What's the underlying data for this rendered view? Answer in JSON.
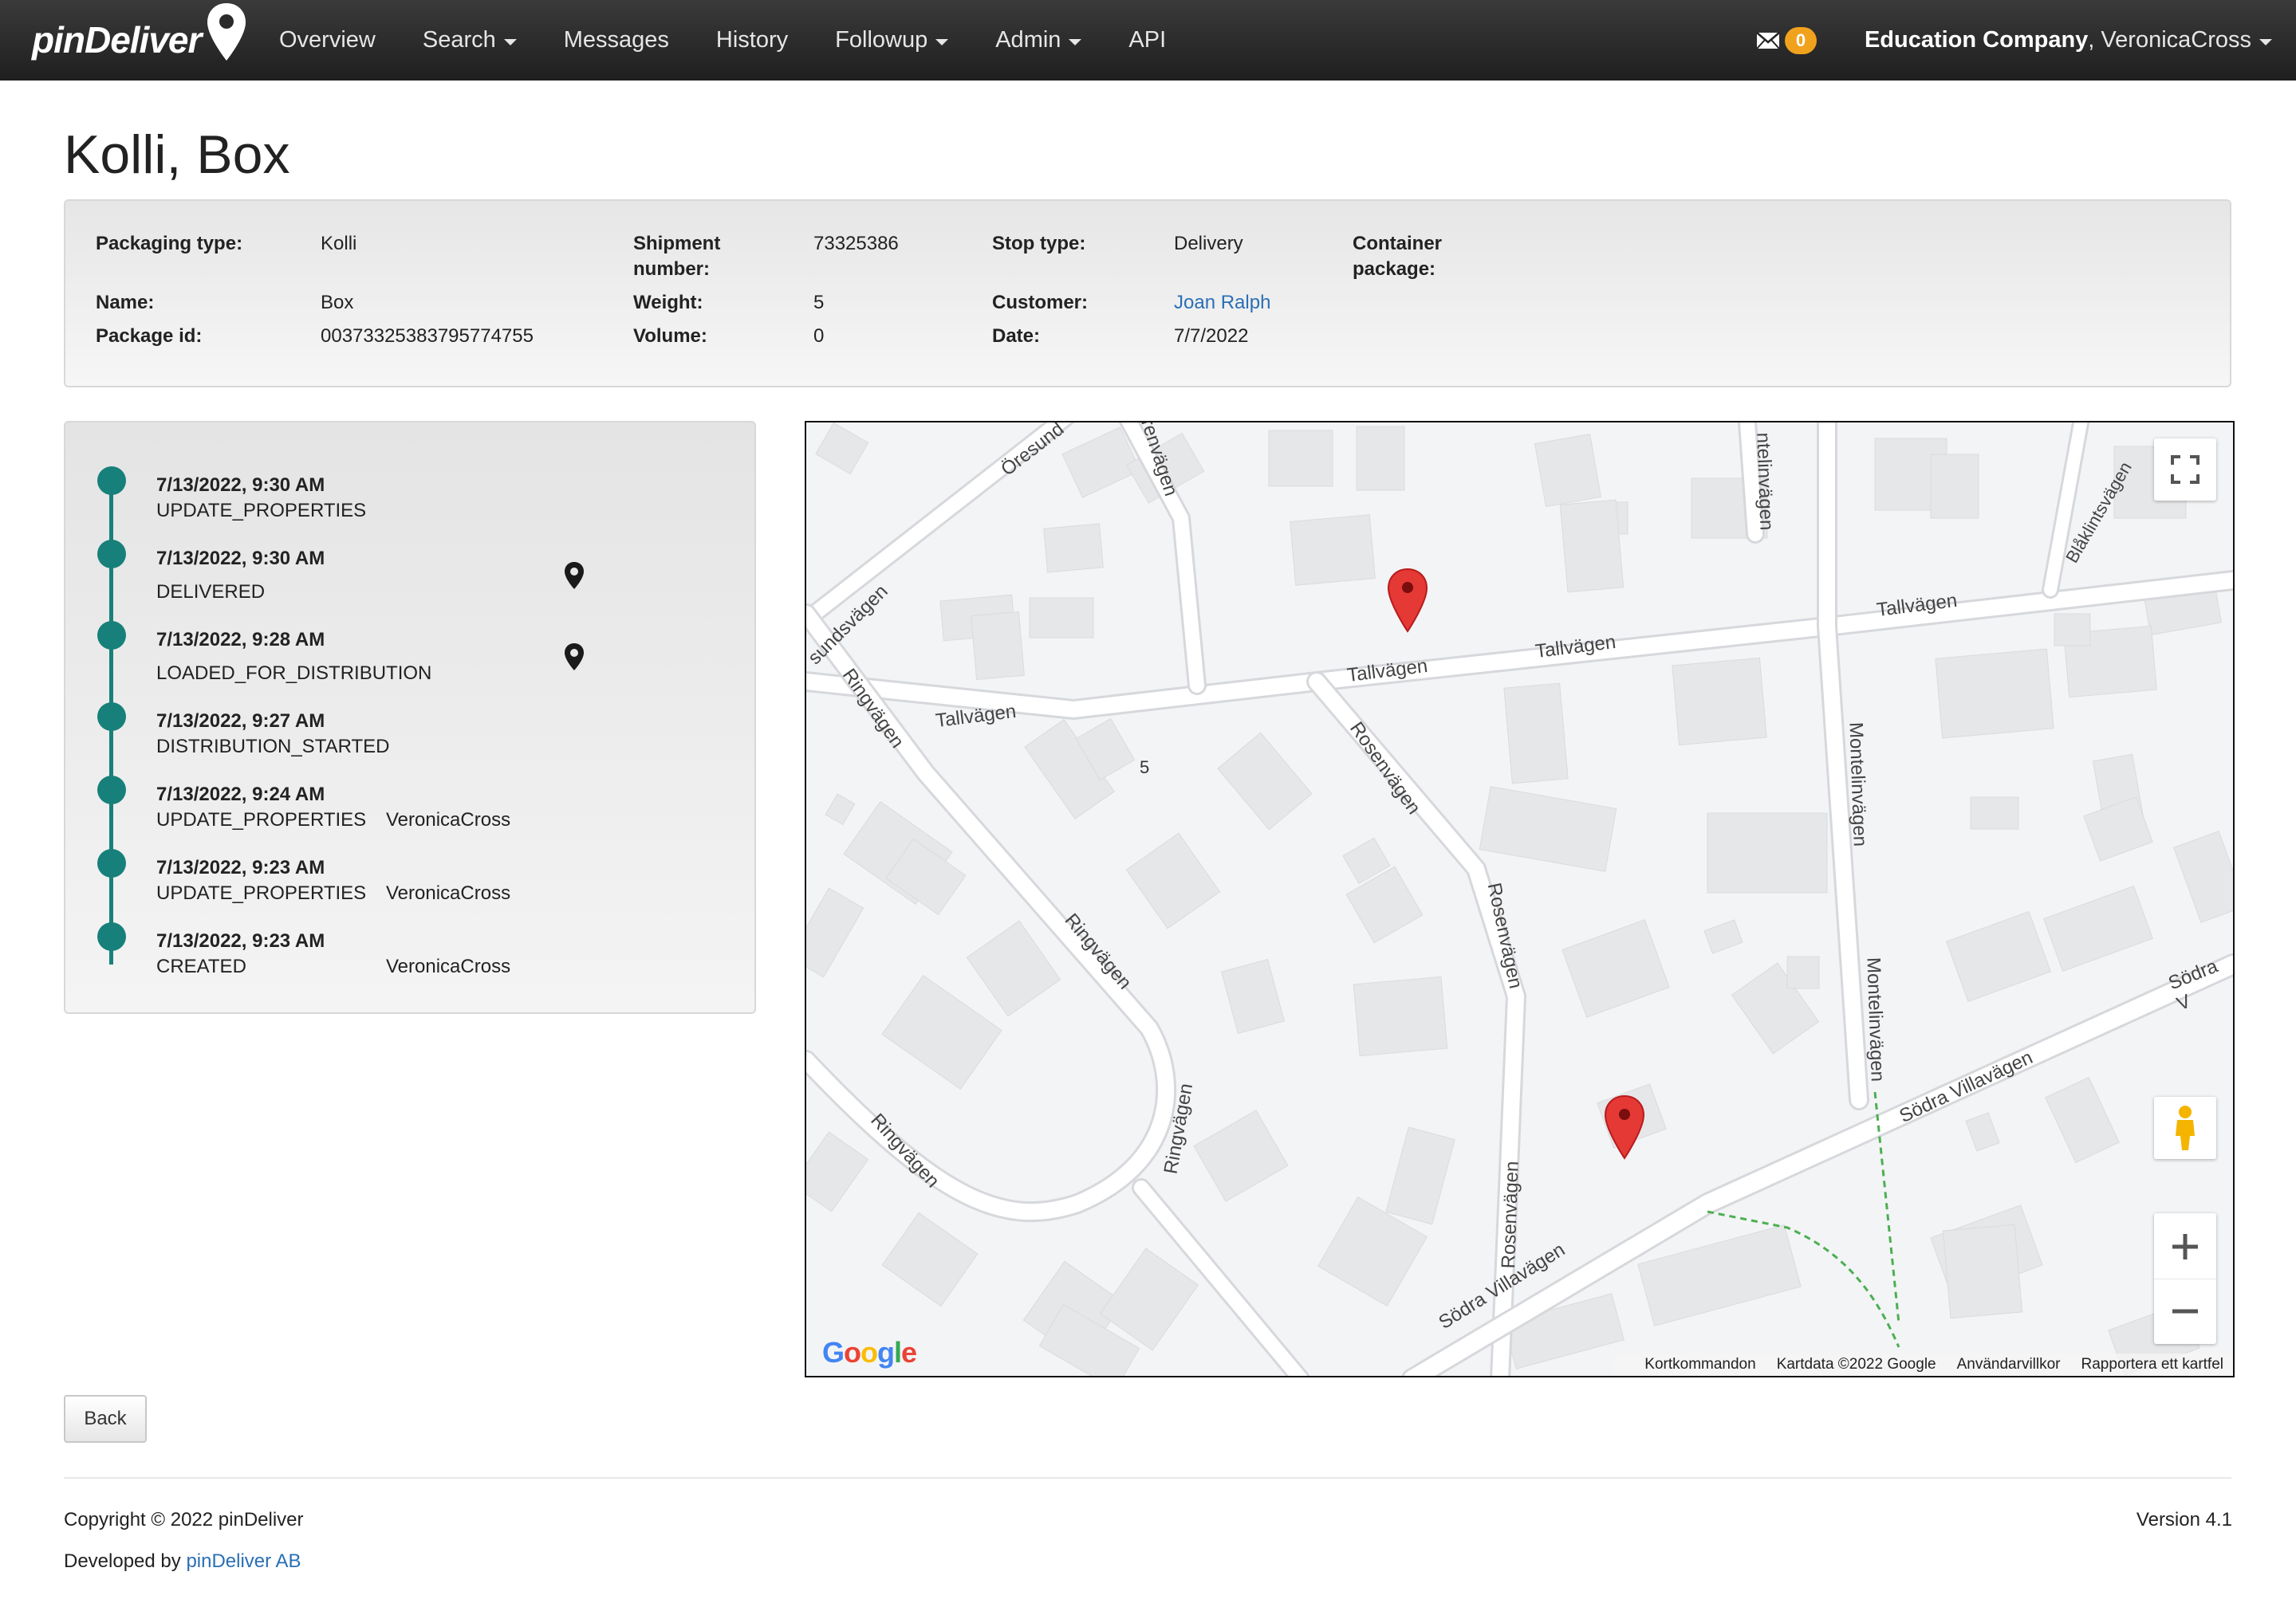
{
  "navbar": {
    "brand": "pinDeliver",
    "items": [
      {
        "label": "Overview",
        "dropdown": false
      },
      {
        "label": "Search",
        "dropdown": true
      },
      {
        "label": "Messages",
        "dropdown": false
      },
      {
        "label": "History",
        "dropdown": false
      },
      {
        "label": "Followup",
        "dropdown": true
      },
      {
        "label": "Admin",
        "dropdown": true
      },
      {
        "label": "API",
        "dropdown": false
      }
    ],
    "message_count": "0",
    "company": "Education Company",
    "user": ", VeronicaCross"
  },
  "page": {
    "title": "Kolli, Box"
  },
  "info": {
    "packaging_type_label": "Packaging type:",
    "packaging_type": "Kolli",
    "name_label": "Name:",
    "name": "Box",
    "package_id_label": "Package id:",
    "package_id": "00373325383795774755",
    "shipment_number_label": "Shipment number:",
    "shipment_number": "73325386",
    "weight_label": "Weight:",
    "weight": "5",
    "volume_label": "Volume:",
    "volume": "0",
    "stop_type_label": "Stop type:",
    "stop_type": "Delivery",
    "customer_label": "Customer:",
    "customer": "Joan Ralph",
    "date_label": "Date:",
    "date": "7/7/2022",
    "container_label": "Container package:"
  },
  "events": [
    {
      "time": "7/13/2022, 9:30 AM",
      "type": "UPDATE_PROPERTIES",
      "user": "",
      "pin": false
    },
    {
      "time": "7/13/2022, 9:30 AM",
      "type": "DELIVERED",
      "user": "",
      "pin": true
    },
    {
      "time": "7/13/2022, 9:28 AM",
      "type": "LOADED_FOR_DISTRIBUTION",
      "user": "",
      "pin": true
    },
    {
      "time": "7/13/2022, 9:27 AM",
      "type": "DISTRIBUTION_STARTED",
      "user": "",
      "pin": false
    },
    {
      "time": "7/13/2022, 9:24 AM",
      "type": "UPDATE_PROPERTIES",
      "user": "VeronicaCross",
      "pin": false
    },
    {
      "time": "7/13/2022, 9:23 AM",
      "type": "UPDATE_PROPERTIES",
      "user": "VeronicaCross",
      "pin": false
    },
    {
      "time": "7/13/2022, 9:23 AM",
      "type": "CREATED",
      "user": "VeronicaCross",
      "pin": false
    }
  ],
  "map": {
    "streets": {
      "tallvagen": "Tallvägen",
      "rosenvagen": "Rosenvägen",
      "ringvagen": "Ringvägen",
      "montelinvagen": "Montelinvägen",
      "sodra_villavagen": "Södra Villavägen",
      "blaklintsvagen": "Blåklintsvägen",
      "oresund": "Öresund",
      "sundsvagen": "sundsvägen",
      "renvagen": "renvägen",
      "ntelinvagen": "ntelinvägen",
      "sodra_cut": "Södra V"
    },
    "house_number": "5",
    "attribution": {
      "shortcuts": "Kortkommandon",
      "mapdata": "Kartdata ©2022 Google",
      "terms": "Användarvillkor",
      "report": "Rapportera ett kartfel"
    },
    "marker_color": "#e53935"
  },
  "buttons": {
    "back": "Back"
  },
  "footer": {
    "copyright": "Copyright © 2022 pinDeliver",
    "developed_by": "Developed by ",
    "company_link": "pinDeliver AB",
    "version": "Version 4.1"
  },
  "colors": {
    "timeline": "#17807a",
    "badge": "#f0a21d",
    "link": "#2a6fb5"
  }
}
